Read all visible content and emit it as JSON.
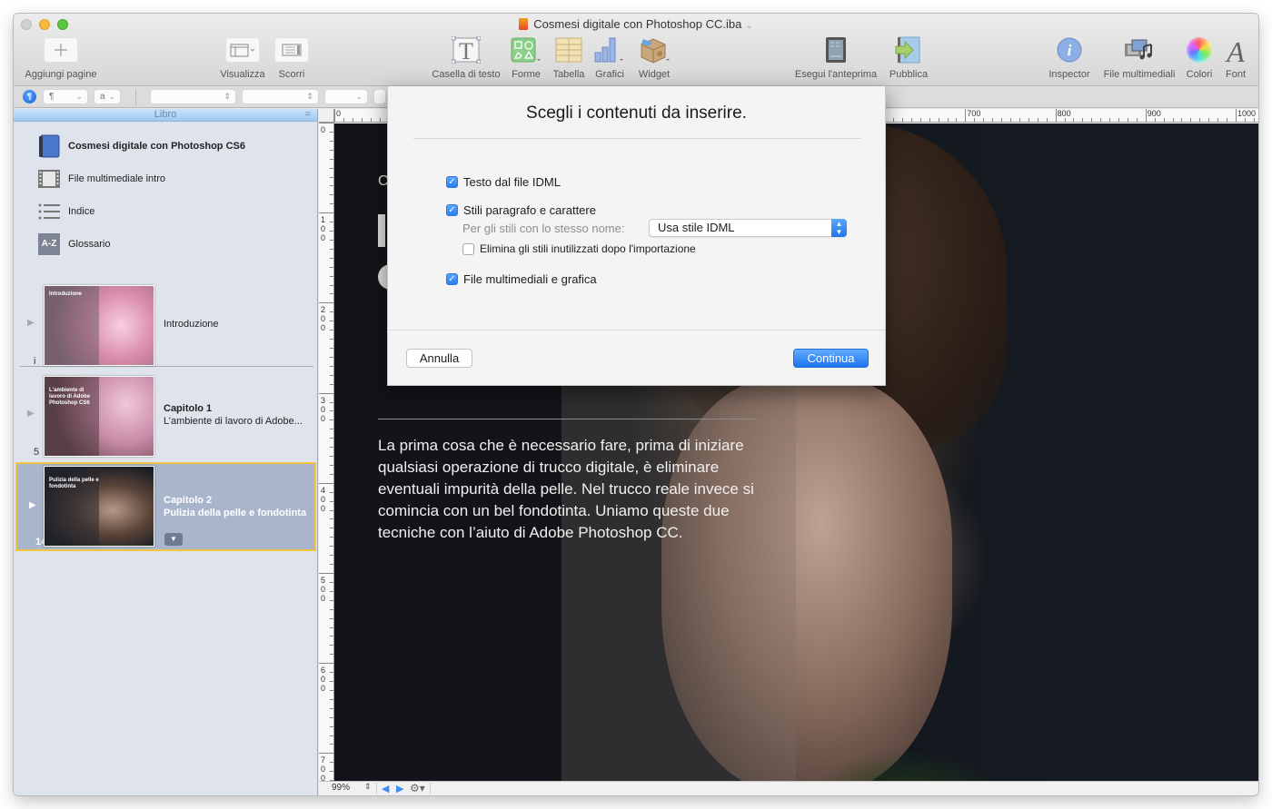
{
  "window": {
    "title": "Cosmesi digitale con Photoshop CC.iba",
    "title_chevron": "⌄"
  },
  "toolbar": {
    "add_pages": "Aggiungi pagine",
    "view": "Visualizza",
    "scroll": "Scorri",
    "text_box": "Casella di testo",
    "shapes": "Forme",
    "table": "Tabella",
    "charts": "Grafici",
    "widget": "Widget",
    "preview": "Esegui l'anteprima",
    "publish": "Pubblica",
    "inspector": "Inspector",
    "media": "File multimediali",
    "colors": "Colori",
    "font": "Font"
  },
  "formatbar": {
    "paragraph_icon": "¶",
    "paragraph_style": "¶",
    "char_style": "a",
    "font_family": "",
    "font_typeface": "",
    "font_size": ""
  },
  "sidebar": {
    "header": "Libro",
    "menu_icon": "=",
    "items": [
      {
        "label": "Cosmesi digitale con Photoshop CS6",
        "icon": "book-icon"
      },
      {
        "label": "File multimediale intro",
        "icon": "film-icon"
      },
      {
        "label": "Indice",
        "icon": "list-icon"
      },
      {
        "label": "Glossario",
        "icon": "glossary-icon",
        "icon_text": "A-Z"
      }
    ],
    "pages": [
      {
        "number": "i",
        "title": "",
        "subtitle": "Introduzione",
        "thumb_title": "Introduzione",
        "selected": false
      },
      {
        "number": "5",
        "title": "Capitolo 1",
        "subtitle": "L’ambiente di lavoro di Adobe...",
        "thumb_title": "L'ambiente di lavoro di Adobe Photoshop CS6",
        "selected": false
      },
      {
        "number": "14",
        "title": "Capitolo 2",
        "subtitle": "Pulizia della pelle e fondotinta",
        "thumb_title": "Pulizia della pelle e fondotinta",
        "selected": true
      }
    ]
  },
  "rulers": {
    "top_labels": [
      "0",
      "700",
      "800",
      "900",
      "1000"
    ],
    "left_labels": [
      "0",
      "100",
      "200",
      "300",
      "400",
      "500",
      "600",
      "700"
    ]
  },
  "canvas": {
    "peek_letter": "C",
    "body_text": "La prima cosa che è necessario fare, prima di iniziare qualsiasi operazione di trucco digitale, è eliminare eventuali impurità della pelle. Nel trucco reale invece si comincia con un bel fondotinta. Uniamo queste due tecniche con l’aiuto di Adobe Photoshop CC."
  },
  "statusbar": {
    "zoom": "99%",
    "stepper": "⇕",
    "prev": "◀",
    "next": "▶",
    "gear": "⚙▾"
  },
  "dialog": {
    "title": "Scegli i contenuti da inserire.",
    "options": [
      {
        "label": "Testo dal file IDML",
        "checked": true
      },
      {
        "label": "Stili paragrafo e carattere",
        "checked": true
      },
      {
        "label": "Elimina gli stili inutilizzati dopo l'importazione",
        "checked": false
      },
      {
        "label": "File multimediali e grafica",
        "checked": true
      }
    ],
    "same_name_label": "Per gli stili con lo stesso nome:",
    "same_name_value": "Usa stile IDML",
    "cancel": "Annulla",
    "continue": "Continua"
  },
  "colors": {
    "accent": "#2b7ef0",
    "selection_border": "#f4c542",
    "selection_bg": "#a8b5cb",
    "sidebar_bg": "#dfe4ec"
  }
}
